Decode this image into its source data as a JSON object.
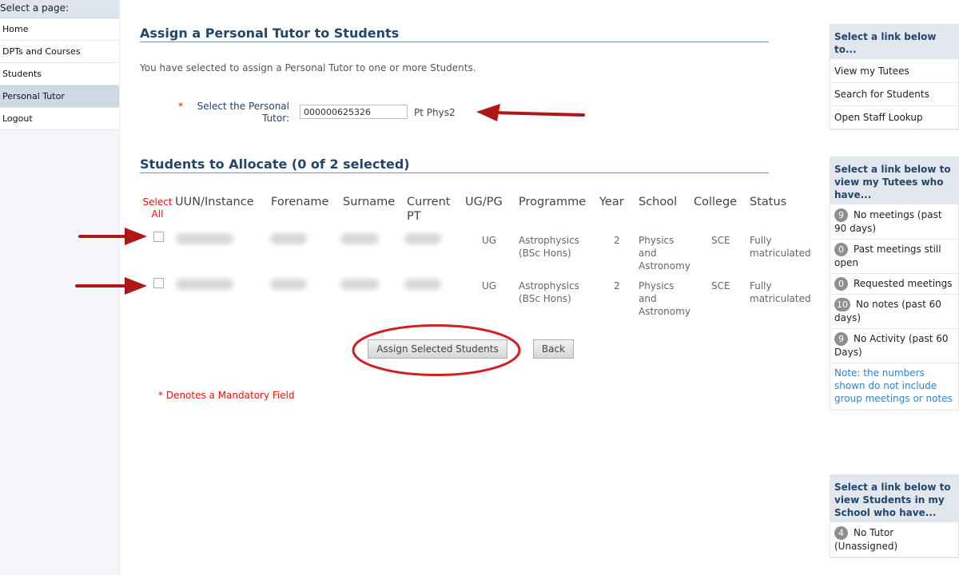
{
  "nav": {
    "header": "Select a page:",
    "items": [
      {
        "label": "Home"
      },
      {
        "label": "DPTs and Courses"
      },
      {
        "label": "Students"
      },
      {
        "label": "Personal Tutor"
      },
      {
        "label": "Logout"
      }
    ]
  },
  "assign": {
    "title": "Assign a Personal Tutor to Students",
    "intro": "You have selected to assign a Personal Tutor to one or more Students.",
    "required_mark": "*",
    "tutor_label": "Select the Personal Tutor:",
    "tutor_value": "000000625326",
    "tutor_name": "Pt Phys2"
  },
  "students": {
    "title": "Students to Allocate (0 of 2 selected)",
    "select_all": "Select All",
    "columns": [
      "UUN/Instance",
      "Forename",
      "Surname",
      "Current PT",
      "UG/PG",
      "Programme",
      "Year",
      "School",
      "College",
      "Status"
    ],
    "rows": [
      {
        "ugpg": "UG",
        "programme": "Astrophysics (BSc Hons)",
        "year": "2",
        "school": "Physics and Astronomy",
        "college": "SCE",
        "status": "Fully matriculated",
        "checked": false
      },
      {
        "ugpg": "UG",
        "programme": "Astrophysics (BSc Hons)",
        "year": "2",
        "school": "Physics and Astronomy",
        "college": "SCE",
        "status": "Fully matriculated",
        "checked": false
      }
    ],
    "assign_button": "Assign Selected Students",
    "back_button": "Back",
    "mandatory_note": "* Denotes a Mandatory Field"
  },
  "sidebar": {
    "links_box": {
      "header": "Select a link below to...",
      "links": [
        "View my Tutees",
        "Search for Students",
        "Open Staff Lookup"
      ]
    },
    "tutees_box": {
      "header": "Select a link below to view my Tutees who have...",
      "items": [
        {
          "count": "9",
          "label": "No meetings (past 90 days)"
        },
        {
          "count": "0",
          "label": "Past meetings still open"
        },
        {
          "count": "0",
          "label": "Requested meetings"
        },
        {
          "count": "10",
          "label": "No notes (past 60 days)"
        },
        {
          "count": "9",
          "label": "No Activity (past 60 Days)"
        }
      ],
      "note": "Note: the numbers shown do not include group meetings or notes"
    },
    "school_box": {
      "header": "Select a link below to view Students in my School who have...",
      "items": [
        {
          "count": "4",
          "label": "No Tutor (Unassigned)"
        }
      ]
    }
  },
  "colors": {
    "heading": "#23466b",
    "required": "#ee1111",
    "annotation": "#b01818",
    "link_note": "#2f86c6"
  }
}
